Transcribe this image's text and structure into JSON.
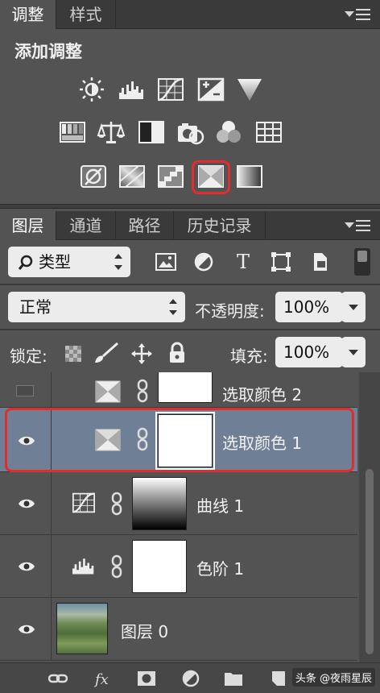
{
  "adjustments_panel": {
    "tabs": [
      {
        "label": "调整",
        "active": true
      },
      {
        "label": "样式",
        "active": false
      }
    ],
    "title": "添加调整",
    "icons_row1": [
      "brightness-contrast-icon",
      "levels-icon",
      "curves-icon",
      "exposure-icon",
      "vibrance-icon"
    ],
    "icons_row2": [
      "hue-saturation-icon",
      "color-balance-icon",
      "black-white-icon",
      "photo-filter-icon",
      "channel-mixer-icon",
      "color-lookup-icon"
    ],
    "icons_row3": [
      "invert-icon",
      "posterize-icon",
      "threshold-icon",
      "selective-color-icon",
      "gradient-map-icon"
    ],
    "highlighted_icon": "selective-color-icon"
  },
  "layers_panel": {
    "tabs": [
      {
        "label": "图层",
        "active": true
      },
      {
        "label": "通道",
        "active": false
      },
      {
        "label": "路径",
        "active": false
      },
      {
        "label": "历史记录",
        "active": false
      }
    ],
    "filter": {
      "label": "类型"
    },
    "blend_mode": "正常",
    "opacity_label": "不透明度:",
    "opacity_value": "100%",
    "lock_label": "锁定:",
    "fill_label": "填充:",
    "fill_value": "100%",
    "layers": [
      {
        "name": "选取颜色 2",
        "visible": false,
        "type": "selective-color",
        "selected": false
      },
      {
        "name": "选取颜色 1",
        "visible": true,
        "type": "selective-color",
        "selected": true
      },
      {
        "name": "曲线 1",
        "visible": true,
        "type": "curves",
        "selected": false
      },
      {
        "name": "色阶 1",
        "visible": true,
        "type": "levels",
        "selected": false
      },
      {
        "name": "图层 0",
        "visible": true,
        "type": "image",
        "selected": false
      }
    ]
  },
  "footer": {
    "watermark": "头条 @夜雨星辰"
  },
  "colors": {
    "panel_bg": "#535353",
    "selected_row": "#6f7f95",
    "highlight_red": "#e02d2d"
  }
}
